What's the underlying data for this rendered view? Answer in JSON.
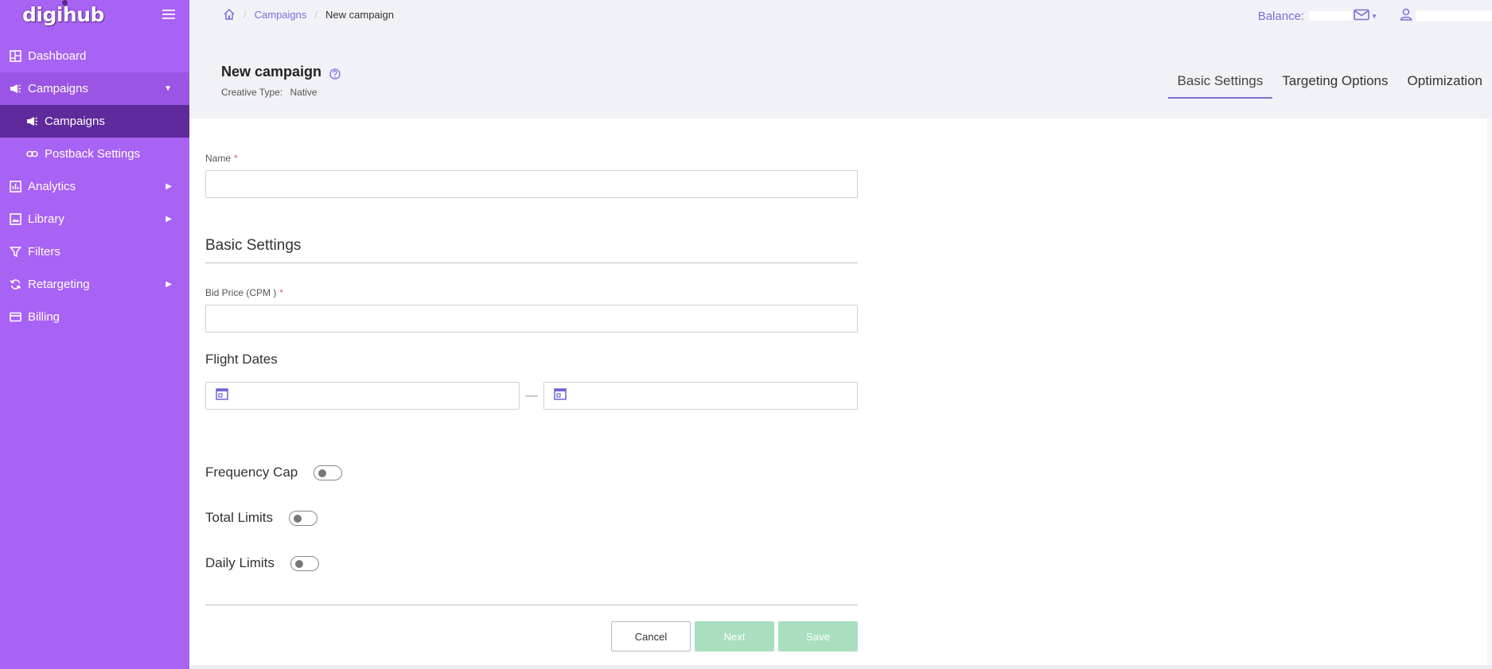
{
  "app": {
    "logo": "digihub"
  },
  "sidebar": {
    "items": [
      {
        "label": "Dashboard",
        "icon": "dashboard-icon"
      },
      {
        "label": "Campaigns",
        "icon": "megaphone-icon"
      },
      {
        "label": "Campaigns",
        "icon": "megaphone-icon"
      },
      {
        "label": "Postback Settings",
        "icon": "link-icon"
      },
      {
        "label": "Analytics",
        "icon": "chart-icon"
      },
      {
        "label": "Library",
        "icon": "image-icon"
      },
      {
        "label": "Filters",
        "icon": "filter-icon"
      },
      {
        "label": "Retargeting",
        "icon": "refresh-icon"
      },
      {
        "label": "Billing",
        "icon": "card-icon"
      }
    ]
  },
  "breadcrumb": {
    "link": "Campaigns",
    "current": "New campaign"
  },
  "topbar": {
    "balance_label": "Balance:"
  },
  "page": {
    "title": "New campaign",
    "creative_label": "Creative Type:",
    "creative_value": "Native"
  },
  "tabs": [
    {
      "label": "Basic Settings",
      "active": true
    },
    {
      "label": "Targeting Options",
      "active": false
    },
    {
      "label": "Optimization",
      "active": false
    }
  ],
  "form": {
    "name_label": "Name",
    "required_mark": "*",
    "section_title": "Basic Settings",
    "bid_label": "Bid Price (CPM )",
    "flight_dates_label": "Flight Dates",
    "frequency_cap_label": "Frequency Cap",
    "total_limits_label": "Total Limits",
    "daily_limits_label": "Daily Limits",
    "cancel_label": "Cancel",
    "next_label": "Next",
    "save_label": "Save",
    "dash": "—"
  },
  "colors": {
    "sidebar": "#a862f4",
    "sidebar_active": "#5e2a9c",
    "accent": "#7b6fd8",
    "disabled_button": "#a9dfbf",
    "header_bg": "#f1f1f8"
  }
}
